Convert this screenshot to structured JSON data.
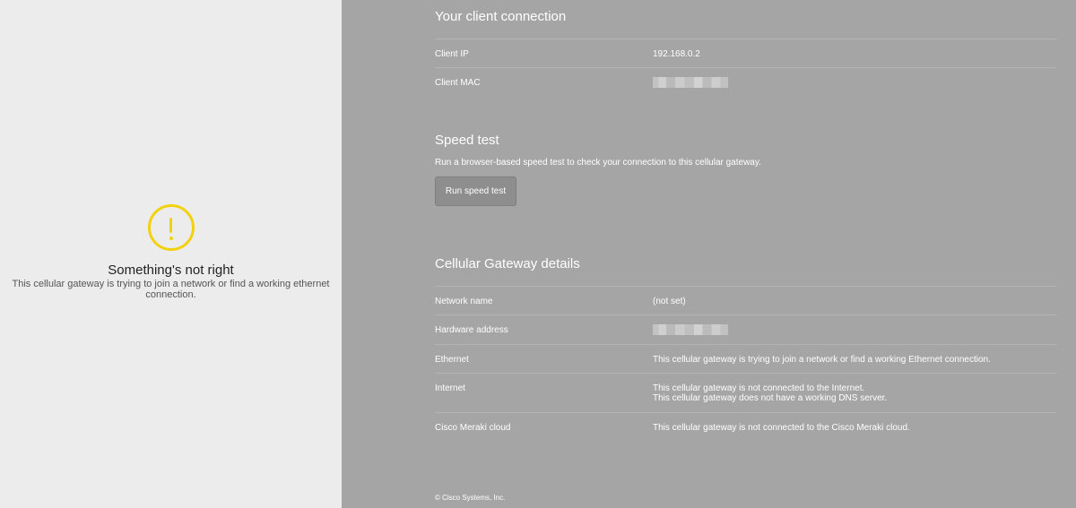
{
  "left": {
    "icon": "warning-circle-icon",
    "title": "Something's not right",
    "description": "This cellular gateway is trying to join a network or find a working ethernet connection."
  },
  "client_connection": {
    "heading": "Your client connection",
    "rows": [
      {
        "label": "Client IP",
        "value": "192.168.0.2"
      },
      {
        "label": "Client MAC",
        "value": ""
      }
    ]
  },
  "speed_test": {
    "heading": "Speed test",
    "description": "Run a browser-based speed test to check your connection to this cellular gateway.",
    "button_label": "Run speed test"
  },
  "gateway_details": {
    "heading": "Cellular Gateway details",
    "rows": [
      {
        "label": "Network name",
        "value": "(not set)"
      },
      {
        "label": "Hardware address",
        "value": ""
      },
      {
        "label": "Ethernet",
        "value": "This cellular gateway is trying to join a network or find a working Ethernet connection."
      },
      {
        "label": "Internet",
        "value": "This cellular gateway is not connected to the Internet.",
        "value2": "This cellular gateway does not have a working DNS server."
      },
      {
        "label": "Cisco Meraki cloud",
        "value": "This cellular gateway is not connected to the Cisco Meraki cloud."
      }
    ]
  },
  "footer": {
    "copyright": "© Cisco Systems, Inc."
  },
  "colors": {
    "left_bg": "#ececec",
    "right_bg": "#a5a5a5",
    "warning": "#f2d10e"
  }
}
